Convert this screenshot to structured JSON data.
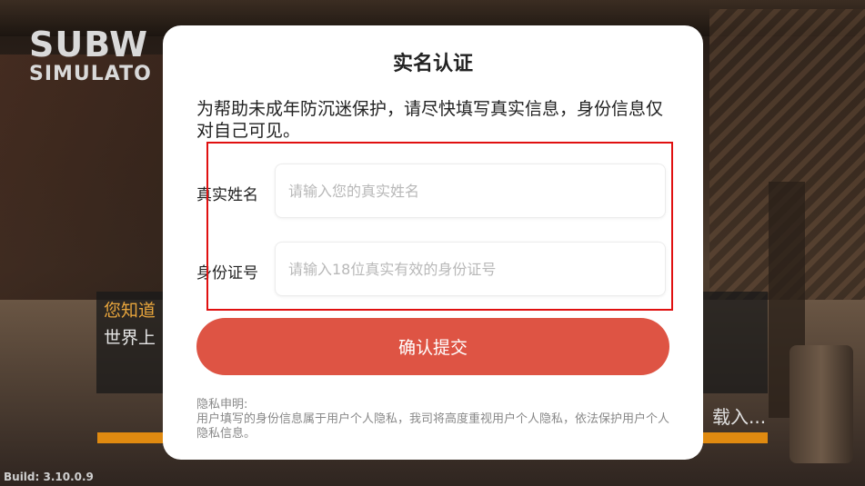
{
  "background": {
    "logo_line1": "SUBW",
    "logo_line2": "SIMULATO",
    "tip_title": "您知道",
    "tip_body": "世界上",
    "loading_text": "载入...",
    "build_label": "Build: 3.10.0.9"
  },
  "dialog": {
    "title": "实名认证",
    "description": "为帮助未成年防沉迷保护，请尽快填写真实信息，身份信息仅对自己可见。",
    "name_label": "真实姓名",
    "name_placeholder": "请输入您的真实姓名",
    "id_label": "身份证号",
    "id_placeholder": "请输入18位真实有效的身份证号",
    "submit_label": "确认提交",
    "privacy_title": "隐私申明:",
    "privacy_text": "用户填写的身份信息属于用户个人隐私，我司将高度重视用户个人隐私，依法保护用户个人隐私信息。"
  },
  "colors": {
    "accent": "#de5444",
    "highlight": "#e01010",
    "loading_bar": "#e08a10",
    "tip_title": "#e8a53c"
  }
}
